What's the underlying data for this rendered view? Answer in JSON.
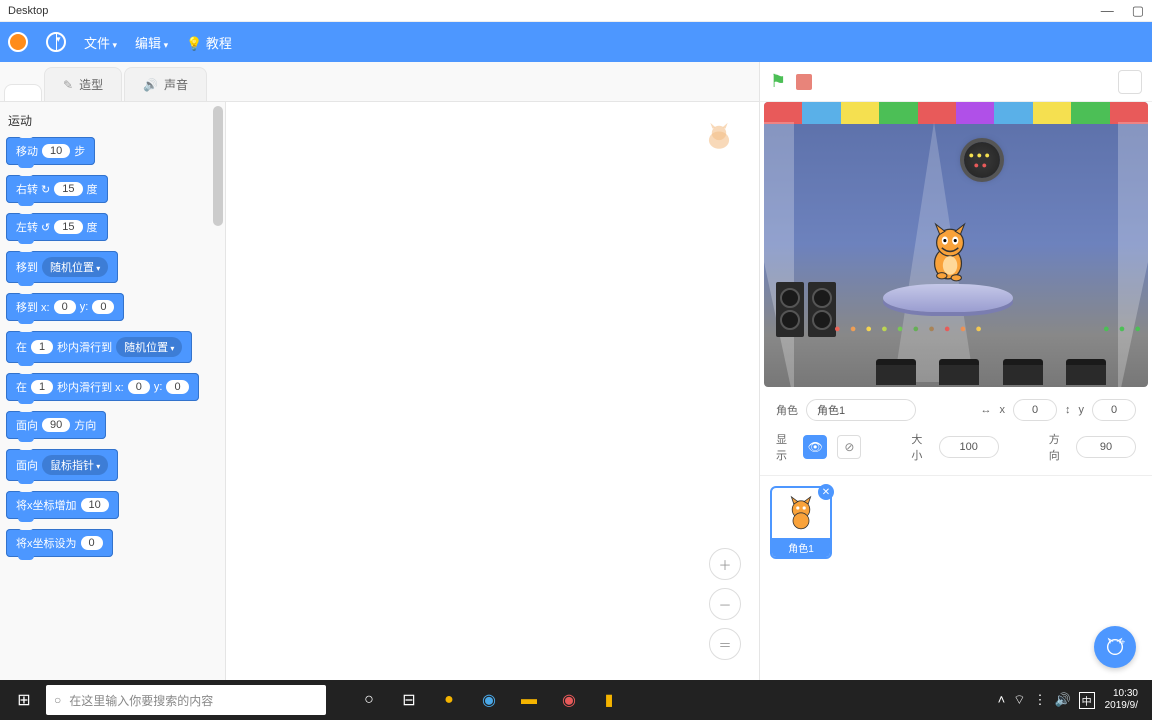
{
  "titlebar": {
    "title": "Desktop"
  },
  "menubar": {
    "file": "文件",
    "edit": "编辑",
    "tutorial": "教程"
  },
  "tabs": {
    "code": "",
    "costumes": "造型",
    "sounds": "声音"
  },
  "palette": {
    "category": "运动",
    "blocks": {
      "move": {
        "pre": "移动",
        "val": "10",
        "post": "步"
      },
      "turn_r": {
        "pre": "右转 ↻",
        "val": "15",
        "post": "度"
      },
      "turn_l": {
        "pre": "左转 ↺",
        "val": "15",
        "post": "度"
      },
      "goto_rand": {
        "pre": "移到",
        "dd": "随机位置"
      },
      "goto_xy": {
        "pre": "移到 x:",
        "x": "0",
        "mid": "y:",
        "y": "0"
      },
      "glide_rand": {
        "pre": "在",
        "sec": "1",
        "mid": "秒内滑行到",
        "dd": "随机位置"
      },
      "glide_xy": {
        "pre": "在",
        "sec": "1",
        "mid": "秒内滑行到 x:",
        "x": "0",
        "mid2": "y:",
        "y": "0"
      },
      "point_dir": {
        "pre": "面向",
        "val": "90",
        "post": "方向"
      },
      "point_towards": {
        "pre": "面向",
        "dd": "鼠标指针"
      },
      "change_x": {
        "pre": "将x坐标增加",
        "val": "10"
      },
      "set_x": {
        "pre": "将x坐标设为",
        "val": "0"
      }
    }
  },
  "sprite_props": {
    "name_label": "角色",
    "name_val": "角色1",
    "x_label": "x",
    "x_val": "0",
    "y_label": "y",
    "y_val": "0",
    "show_label": "显示",
    "size_label": "大小",
    "size_val": "100",
    "dir_label": "方向",
    "dir_val": "90"
  },
  "sprite_thumb": {
    "name": "角色1"
  },
  "taskbar": {
    "search_placeholder": "在这里输入你要搜索的内容",
    "time": "10:30",
    "date": "2019/9/"
  }
}
